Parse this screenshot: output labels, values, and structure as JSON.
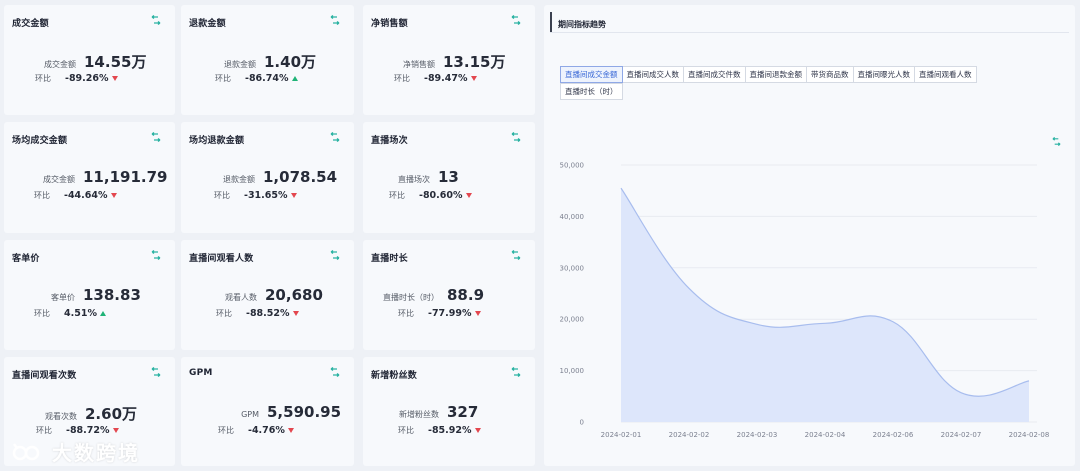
{
  "cards": [
    {
      "title": "成交金额",
      "label": "成交金额",
      "value": "14.55万",
      "compare_label": "环比",
      "compare_value": "-89.26%",
      "trend": "down"
    },
    {
      "title": "退款金额",
      "label": "退款金额",
      "value": "1.40万",
      "compare_label": "环比",
      "compare_value": "-86.74%",
      "trend": "up"
    },
    {
      "title": "净销售额",
      "label": "净销售额",
      "value": "13.15万",
      "compare_label": "环比",
      "compare_value": "-89.47%",
      "trend": "down"
    },
    {
      "title": "场均成交金额",
      "label": "成交金额",
      "value": "11,191.79",
      "compare_label": "环比",
      "compare_value": "-44.64%",
      "trend": "down"
    },
    {
      "title": "场均退款金额",
      "label": "退款金额",
      "value": "1,078.54",
      "compare_label": "环比",
      "compare_value": "-31.65%",
      "trend": "down"
    },
    {
      "title": "直播场次",
      "label": "直播场次",
      "value": "13",
      "compare_label": "环比",
      "compare_value": "-80.60%",
      "trend": "down"
    },
    {
      "title": "客单价",
      "label": "客单价",
      "value": "138.83",
      "compare_label": "环比",
      "compare_value": "4.51%",
      "trend": "up"
    },
    {
      "title": "直播间观看人数",
      "label": "观看人数",
      "value": "20,680",
      "compare_label": "环比",
      "compare_value": "-88.52%",
      "trend": "down"
    },
    {
      "title": "直播时长",
      "label": "直播时长（时）",
      "value": "88.9",
      "compare_label": "环比",
      "compare_value": "-77.99%",
      "trend": "down"
    },
    {
      "title": "直播间观看次数",
      "label": "观看次数",
      "value": "2.60万",
      "compare_label": "环比",
      "compare_value": "-88.72%",
      "trend": "down"
    },
    {
      "title": "GPM",
      "label": "GPM",
      "value": "5,590.95",
      "compare_label": "环比",
      "compare_value": "-4.76%",
      "trend": "down"
    },
    {
      "title": "新增粉丝数",
      "label": "新增粉丝数",
      "value": "327",
      "compare_label": "环比",
      "compare_value": "-85.92%",
      "trend": "down"
    }
  ],
  "panel": {
    "title": "期间指标趋势",
    "tabs": [
      "直播间成交金额",
      "直播间成交人数",
      "直播间成交件数",
      "直播间退款金额",
      "带货商品数",
      "直播间曝光人数",
      "直播间观看人数",
      "直播时长（时）"
    ],
    "active_tab": 0
  },
  "chart_data": {
    "type": "area",
    "x": [
      "2024-02-01",
      "2024-02-02",
      "2024-02-03",
      "2024-02-04",
      "2024-02-06",
      "2024-02-07",
      "2024-02-08"
    ],
    "values": [
      45500,
      26000,
      19000,
      19200,
      19500,
      5700,
      8000
    ],
    "ylim": [
      0,
      50000
    ],
    "yticks": [
      "0",
      "10,000",
      "20,000",
      "30,000",
      "40,000",
      "50,000"
    ],
    "grid": true,
    "colors": {
      "fill": "#dde6fb",
      "line": "#a8bdee"
    }
  },
  "watermark": {
    "text": "大数跨境"
  }
}
